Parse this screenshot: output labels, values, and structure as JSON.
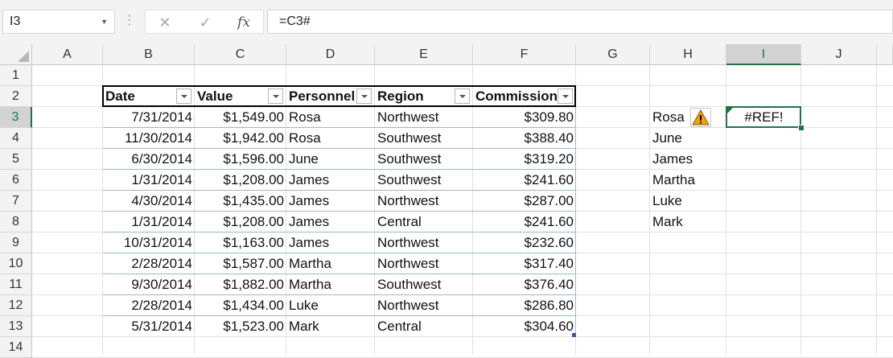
{
  "formula_bar": {
    "name_box": "I3",
    "cancel_icon": "✕",
    "enter_icon": "✓",
    "function_icon": "fx",
    "formula": "=C3#"
  },
  "columns": [
    "A",
    "B",
    "C",
    "D",
    "E",
    "F",
    "G",
    "H",
    "I",
    "J"
  ],
  "rows": [
    "1",
    "2",
    "3",
    "4",
    "5",
    "6",
    "7",
    "8",
    "9",
    "10",
    "11",
    "12",
    "13",
    "14"
  ],
  "selected_column": "I",
  "selected_row": "3",
  "table": {
    "headers": [
      "Date",
      "Value",
      "Personnel",
      "Region",
      "Commission"
    ],
    "rows": [
      [
        "7/31/2014",
        "$1,549.00",
        "Rosa",
        "Northwest",
        "$309.80"
      ],
      [
        "11/30/2014",
        "$1,942.00",
        "Rosa",
        "Southwest",
        "$388.40"
      ],
      [
        "6/30/2014",
        "$1,596.00",
        "June",
        "Southwest",
        "$319.20"
      ],
      [
        "1/31/2014",
        "$1,208.00",
        "James",
        "Southwest",
        "$241.60"
      ],
      [
        "4/30/2014",
        "$1,435.00",
        "James",
        "Northwest",
        "$287.00"
      ],
      [
        "1/31/2014",
        "$1,208.00",
        "James",
        "Central",
        "$241.60"
      ],
      [
        "10/31/2014",
        "$1,163.00",
        "James",
        "Northwest",
        "$232.60"
      ],
      [
        "2/28/2014",
        "$1,587.00",
        "Martha",
        "Northwest",
        "$317.40"
      ],
      [
        "9/30/2014",
        "$1,882.00",
        "Martha",
        "Southwest",
        "$376.40"
      ],
      [
        "2/28/2014",
        "$1,434.00",
        "Luke",
        "Northwest",
        "$286.80"
      ],
      [
        "5/31/2014",
        "$1,523.00",
        "Mark",
        "Central",
        "$304.60"
      ]
    ]
  },
  "names_list": [
    "Rosa",
    "June",
    "James",
    "Martha",
    "Luke",
    "Mark"
  ],
  "active_cell_value": "#REF!",
  "colors": {
    "selection": "#217346",
    "warning": "#f0a30a",
    "table_resize": "#2f5d9a"
  }
}
